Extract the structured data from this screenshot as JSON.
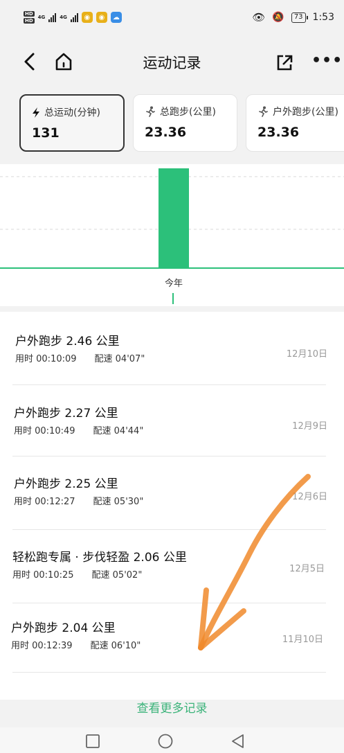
{
  "status_bar": {
    "hd1": "HD",
    "hd2": "HD",
    "net1": "4G",
    "net2": "4G",
    "battery": "73",
    "time": "1:53"
  },
  "header": {
    "title": "运动记录"
  },
  "stats": [
    {
      "label": "总运动(分钟)",
      "value": "131",
      "icon": "lightning-icon"
    },
    {
      "label": "总跑步(公里)",
      "value": "23.36",
      "icon": "runner-icon"
    },
    {
      "label": "户外跑步(公里)",
      "value": "23.36",
      "icon": "runner-icon"
    }
  ],
  "chart": {
    "x_label": "今年",
    "colors": {
      "bar": "#2cc07a",
      "baseline": "#2cc07a",
      "grid": "#d8d8d8"
    }
  },
  "chart_data": {
    "type": "bar",
    "categories": [
      "今年"
    ],
    "values": [
      131
    ]
  },
  "records": [
    {
      "title": "户外跑步 2.46 公里",
      "duration": "用时 00:10:09",
      "pace": "配速 04'07\"",
      "date": "12月10日"
    },
    {
      "title": "户外跑步 2.27 公里",
      "duration": "用时 00:10:49",
      "pace": "配速 04'44\"",
      "date": "12月9日"
    },
    {
      "title": "户外跑步 2.25 公里",
      "duration": "用时 00:12:27",
      "pace": "配速 05'30\"",
      "date": "12月6日"
    },
    {
      "title": "轻松跑专属 · 步伐轻盈 2.06 公里",
      "duration": "用时 00:10:25",
      "pace": "配速 05'02\"",
      "date": "12月5日"
    },
    {
      "title": "户外跑步 2.04 公里",
      "duration": "用时 00:12:39",
      "pace": "配速 06'10\"",
      "date": "11月10日"
    }
  ],
  "more_link": "查看更多记录",
  "accent": "#3cb37a",
  "annotation_color": "#f08a2c"
}
